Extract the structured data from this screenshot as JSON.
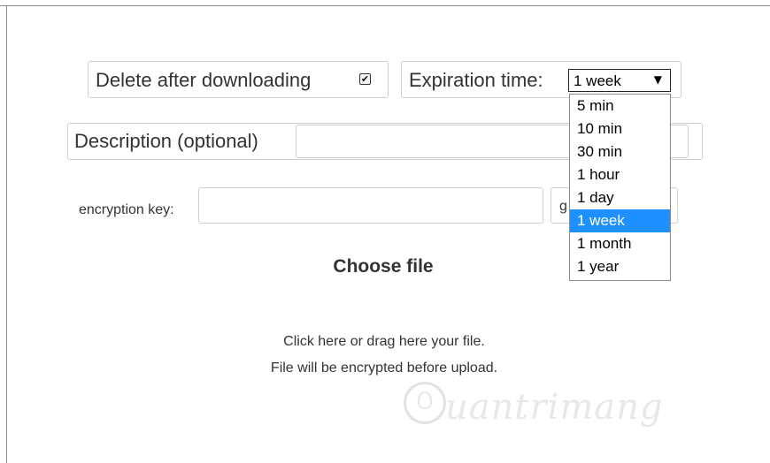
{
  "options": {
    "delete_after_downloading_label": "Delete after downloading",
    "delete_after_downloading_checked": true,
    "check_mark": "✔",
    "expiration_label": "Expiration time:",
    "expiration_selected": "1 week",
    "expiration_arrow": "▼",
    "expiration_options": [
      "5 min",
      "10 min",
      "30 min",
      "1 hour",
      "1 day",
      "1 week",
      "1 month",
      "1 year"
    ],
    "expiration_highlighted_index": 5
  },
  "description": {
    "label": "Description (optional)",
    "value": ""
  },
  "encryption": {
    "label": "encryption key:",
    "value": "",
    "generate_button_partial": "g"
  },
  "upload": {
    "title": "Choose file",
    "line1": "Click here or drag here your file.",
    "line2": "File will be encrypted before upload."
  },
  "watermark": {
    "text": "uantrimang"
  },
  "colors": {
    "highlight": "#1e90ff",
    "border": "#cfcfcf"
  }
}
